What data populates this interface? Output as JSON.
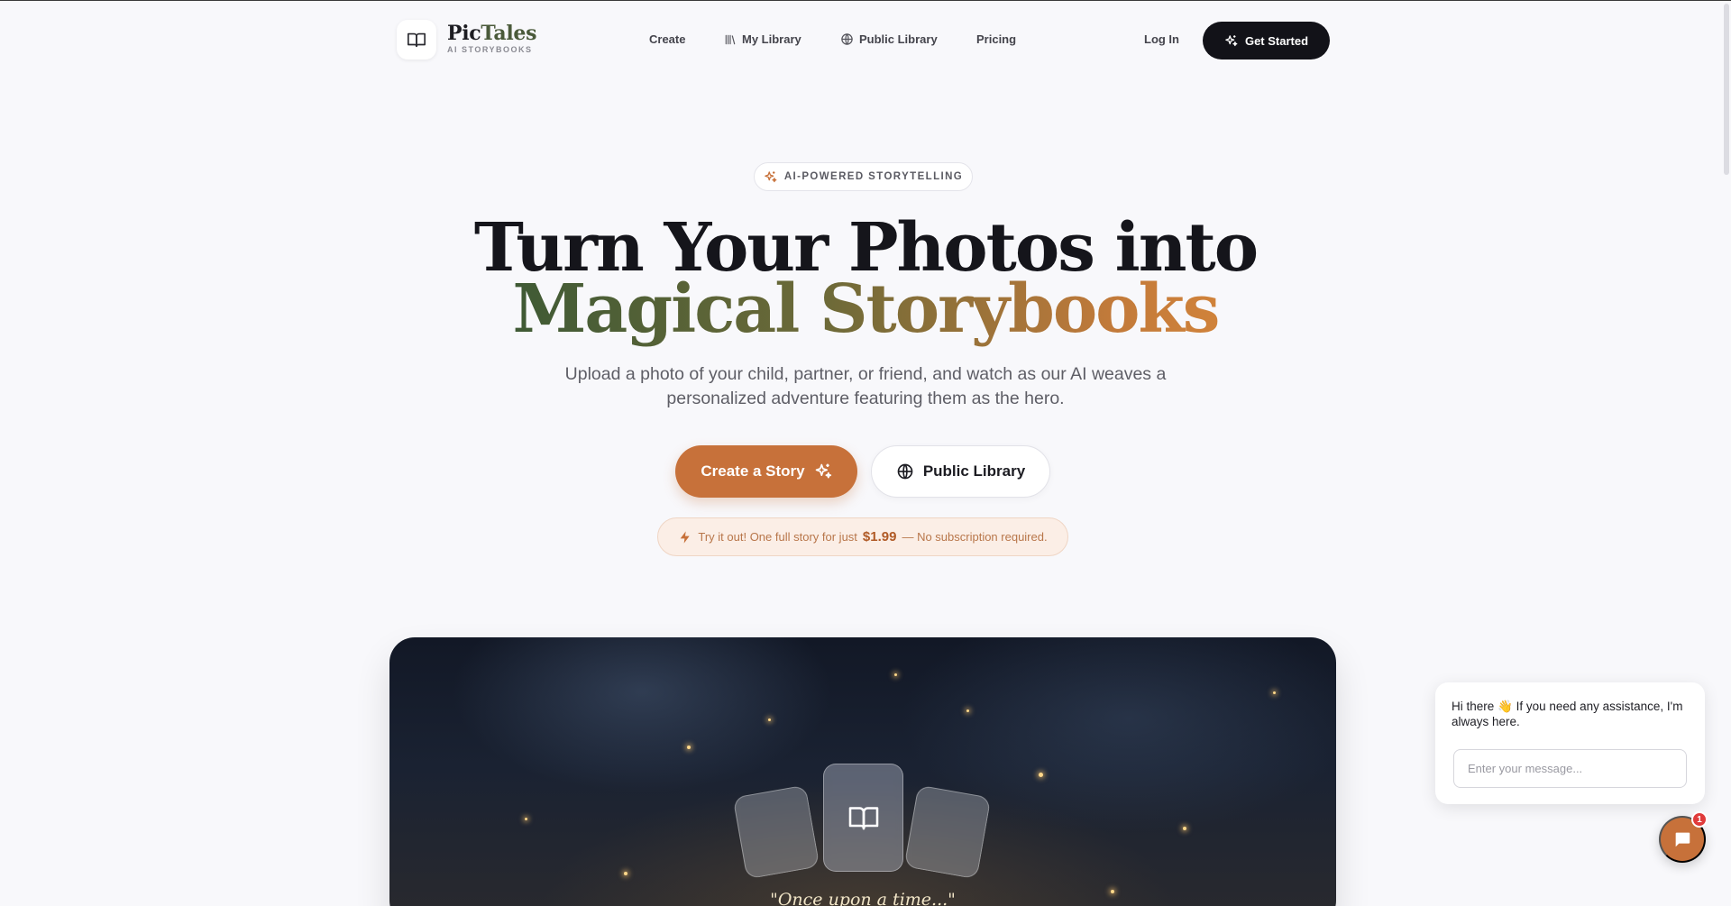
{
  "brand": {
    "name_part1": "Pic",
    "name_part2": "Tales",
    "tagline": "AI STORYBOOKS"
  },
  "nav": {
    "create": "Create",
    "my_library": "My Library",
    "public_library": "Public Library",
    "pricing": "Pricing",
    "login": "Log In",
    "get_started": "Get Started"
  },
  "hero": {
    "badge": "AI-POWERED STORYTELLING",
    "title_line1": "Turn Your Photos into",
    "title_line2": "Magical Storybooks",
    "subtitle": "Upload a photo of your child, partner, or friend, and watch as our AI weaves a personalized adventure featuring them as the hero.",
    "cta_primary": "Create a Story",
    "cta_secondary": "Public Library",
    "promo_prefix": "Try it out! One full story for just",
    "promo_price": "$1.99",
    "promo_suffix": "— No subscription required."
  },
  "showcase": {
    "quote": "\"Once upon a time...\""
  },
  "chat": {
    "greeting": "Hi there 👋 If you need any assistance, I'm always here.",
    "input_placeholder": "Enter your message...",
    "unread_count": "1"
  },
  "icons": {
    "logo": "open-book-icon",
    "library": "library-icon",
    "globe": "globe-icon",
    "sparkles": "sparkles-icon",
    "bolt": "lightning-icon",
    "chat": "chat-icon"
  },
  "colors": {
    "accent": "#c7713a",
    "dark": "#121218",
    "background": "#f8f8fb",
    "title_gradient_start": "#3f5a35",
    "title_gradient_end": "#d0823a"
  }
}
